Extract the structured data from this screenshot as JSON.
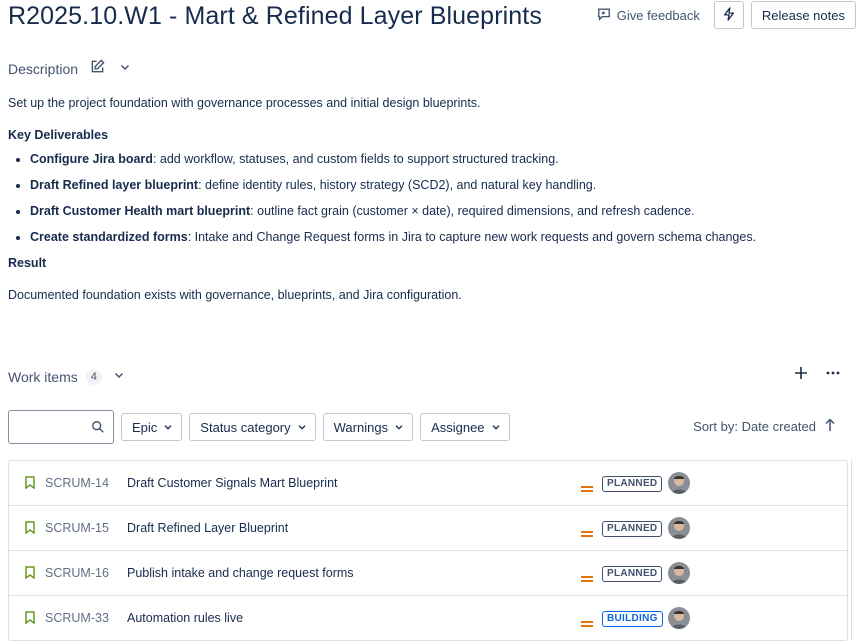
{
  "header": {
    "title": "R2025.10.W1 - Mart & Refined Layer Blueprints",
    "give_feedback": "Give feedback",
    "release_notes": "Release notes"
  },
  "description": {
    "label": "Description",
    "intro": "Set up the project foundation with governance processes and initial design blueprints.",
    "deliverables_heading": "Key Deliverables",
    "deliverables": [
      {
        "bold": "Configure Jira board",
        "rest": ": add workflow, statuses, and custom fields to support structured tracking."
      },
      {
        "bold": "Draft Refined layer blueprint",
        "rest": ": define identity rules, history strategy (SCD2), and natural key handling."
      },
      {
        "bold": "Draft Customer Health mart blueprint",
        "rest": ": outline fact grain (customer × date), required dimensions, and refresh cadence."
      },
      {
        "bold": "Create standardized forms",
        "rest": ": Intake and Change Request forms in Jira to capture new work requests and govern schema changes."
      }
    ],
    "result_heading": "Result",
    "result": "Documented foundation exists with governance, blueprints, and Jira configuration."
  },
  "work_items": {
    "label": "Work items",
    "count": "4",
    "search_placeholder": "",
    "filters": [
      "Epic",
      "Status category",
      "Warnings",
      "Assignee"
    ],
    "sort_label": "Sort by: Date created",
    "items": [
      {
        "key": "SCRUM-14",
        "summary": "Draft Customer Signals Mart Blueprint",
        "status": "PLANNED"
      },
      {
        "key": "SCRUM-15",
        "summary": "Draft Refined Layer Blueprint",
        "status": "PLANNED"
      },
      {
        "key": "SCRUM-16",
        "summary": "Publish intake and change request forms",
        "status": "PLANNED"
      },
      {
        "key": "SCRUM-33",
        "summary": "Automation rules live",
        "status": "BUILDING"
      }
    ]
  },
  "colors": {
    "planned_border": "#42526e",
    "planned_text": "#42526e",
    "building_border": "#0c66e4",
    "building_text": "#0c66e4",
    "story_icon": "#6a9a23",
    "priority_medium": "#e2740b"
  },
  "icons": {
    "edit": "pencil-square-icon",
    "feedback": "speech-bubble-icon",
    "bolt": "lightning-bolt-icon",
    "search": "magnifier-icon",
    "add": "plus-icon",
    "more": "ellipsis-icon",
    "sort": "arrow-up-icon",
    "item_type": "bookmark-icon",
    "priority": "equals-priority-icon",
    "assignee": "avatar"
  }
}
